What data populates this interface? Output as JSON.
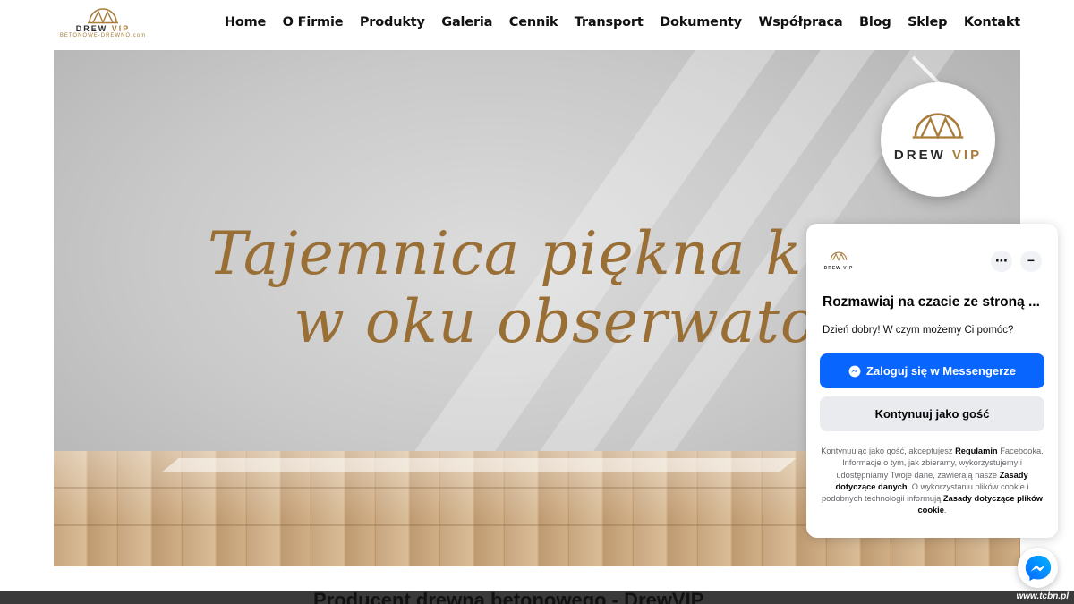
{
  "logo": {
    "brand": "DREW",
    "brand_accent": "VIP",
    "sub": "BETONOWE-DREWNO.com"
  },
  "nav": [
    "Home",
    "O Firmie",
    "Produkty",
    "Galeria",
    "Cennik",
    "Transport",
    "Dokumenty",
    "Współpraca",
    "Blog",
    "Sklep",
    "Kontakt"
  ],
  "hero": {
    "slogan_line1": "Tajemnica piękna kryje się",
    "slogan_line2": "w oku obserwatora...",
    "badge_brand": "DREW",
    "badge_accent": "VIP"
  },
  "chat": {
    "logo_text": "DREW VIP",
    "more_icon": "⋯",
    "minimize_icon": "−",
    "title": "Rozmawiaj na czacie ze stroną ...",
    "greeting": "Dzień dobry! W czym możemy Ci pomóc?",
    "messenger_button": "Zaloguj się w Messengerze",
    "guest_button": "Kontynuuj jako gość",
    "legal": {
      "p1": "Kontynuując jako gość, akceptujesz ",
      "link1": "Regulamin",
      "p2": " Facebooka. Informacje o tym, jak zbieramy, wykorzystujemy i udostępniamy Twoje dane, zawierają nasze ",
      "link2": "Zasady dotyczące danych",
      "p3": ". O wykorzystaniu plików cookie i podobnych technologii informują ",
      "link3": "Zasady dotyczące plików cookie",
      "p4": "."
    }
  },
  "page_heading": "Producent drewna betonowego - DrewVIP",
  "watermark": "www.tcbn.pl",
  "colors": {
    "gold": "#a87d3c",
    "messenger_blue": "#0866ff"
  }
}
